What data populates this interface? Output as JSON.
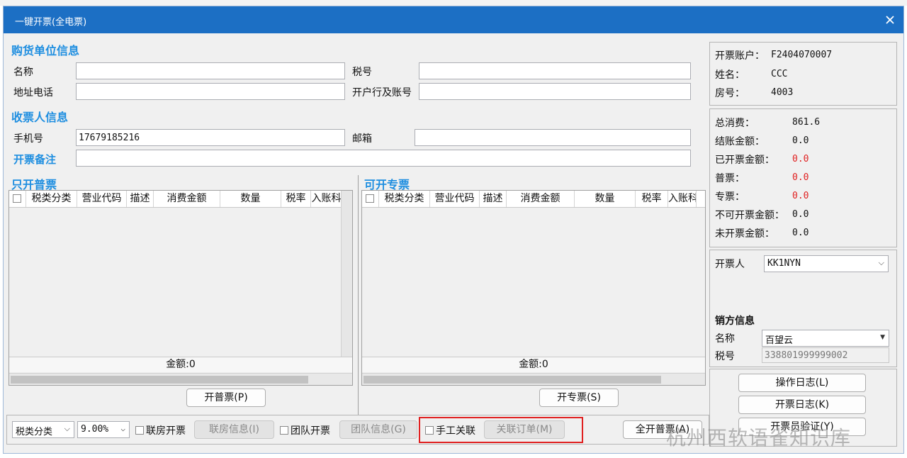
{
  "window": {
    "title": "一键开票(全电票)",
    "close_symbol": "✕"
  },
  "buyer": {
    "section_title": "购货单位信息",
    "name_label": "名称",
    "name_value": "",
    "taxno_label": "税号",
    "taxno_value": "",
    "address_label": "地址电话",
    "address_value": "",
    "bank_label": "开户行及账号",
    "bank_value": ""
  },
  "receiver": {
    "section_title": "收票人信息",
    "phone_label": "手机号",
    "phone_value": "17679185216",
    "email_label": "邮箱",
    "email_value": ""
  },
  "remark": {
    "label": "开票备注",
    "value": ""
  },
  "normal_invoice": {
    "section_title": "只开普票",
    "columns": [
      "税类分类",
      "营业代码",
      "描述",
      "消费金额",
      "数量",
      "税率",
      "入账科"
    ],
    "sum_label": "金额:0",
    "button_label": "开普票(P)"
  },
  "special_invoice": {
    "section_title": "可开专票",
    "columns": [
      "税类分类",
      "营业代码",
      "描述",
      "消费金额",
      "数量",
      "税率",
      "入账科"
    ],
    "sum_label": "金额:0",
    "button_label": "开专票(S)"
  },
  "account": {
    "account_label": "开票账户：",
    "account_value": "F2404070007",
    "name_label": "姓名：",
    "name_value": "CCC",
    "room_label": "房号：",
    "room_value": "4003"
  },
  "amounts": [
    {
      "label": "总消费：",
      "value": "861.6",
      "red": false
    },
    {
      "label": "结账金额：",
      "value": "0.0",
      "red": false
    },
    {
      "label": "已开票金额：",
      "value": "0.0",
      "red": true
    },
    {
      "label": "普票：",
      "value": "0.0",
      "red": true
    },
    {
      "label": "专票：",
      "value": "0.0",
      "red": true
    },
    {
      "label": "不可开票金额：",
      "value": "0.0",
      "red": false
    },
    {
      "label": "未开票金额：",
      "value": "0.0",
      "red": false
    }
  ],
  "issuer": {
    "label": "开票人",
    "value": "KK1NYN"
  },
  "seller": {
    "section_title": "销方信息",
    "name_label": "名称",
    "name_value": "百望云",
    "taxno_label": "税号",
    "taxno_value": "338801999999002"
  },
  "right_buttons": {
    "operation_log": "操作日志(L)",
    "invoice_log": "开票日志(K)",
    "verify": "开票员验证(Y)"
  },
  "bottom": {
    "tax_category": "税类分类",
    "tax_rate": "9.00%",
    "joint_room_label": "联房开票",
    "joint_room_info_button": "联房信息(I)",
    "team_label": "团队开票",
    "team_info_button": "团队信息(G)",
    "manual_link_label": "手工关联",
    "link_order_button": "关联订单(M)",
    "issue_all_button": "全开普票(A)"
  },
  "watermark": "杭州西软语雀知识库",
  "colors": {
    "titlebar": "#1c6fc4",
    "section_title": "#1e8ee0",
    "red_value": "#e02020"
  }
}
